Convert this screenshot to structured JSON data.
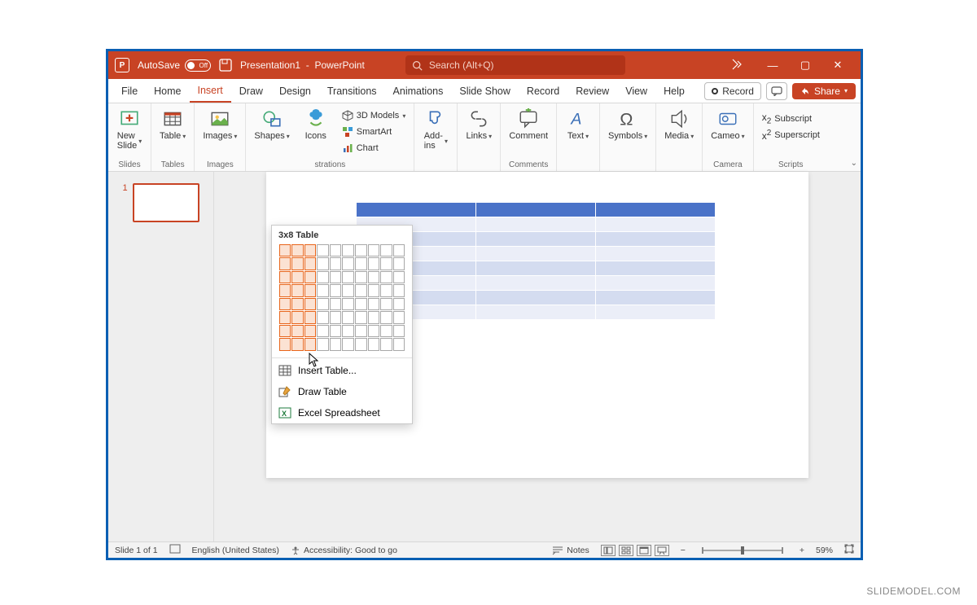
{
  "titlebar": {
    "autosave_label": "AutoSave",
    "autosave_state": "Off",
    "doc_name": "Presentation1",
    "app_name": "PowerPoint",
    "search_placeholder": "Search (Alt+Q)"
  },
  "window": {
    "minimize": "—",
    "maximize": "▢",
    "close": "✕"
  },
  "tabs": {
    "file": "File",
    "home": "Home",
    "insert": "Insert",
    "draw": "Draw",
    "design": "Design",
    "transitions": "Transitions",
    "animations": "Animations",
    "slideshow": "Slide Show",
    "record": "Record",
    "review": "Review",
    "view": "View",
    "help": "Help"
  },
  "tabs_right": {
    "record_btn": "Record",
    "share_btn": "Share"
  },
  "ribbon": {
    "slides": {
      "new_slide": "New\nSlide",
      "group": "Slides"
    },
    "tables": {
      "table": "Table",
      "group": "Tables"
    },
    "images": {
      "images": "Images",
      "group": "Images"
    },
    "illustrations": {
      "shapes": "Shapes",
      "icons": "Icons",
      "models3d": "3D Models",
      "smartart": "SmartArt",
      "chart": "Chart",
      "group": "strations"
    },
    "addins": {
      "addins": "Add-\nins",
      "group": ""
    },
    "links": {
      "links": "Links",
      "group": ""
    },
    "comments": {
      "comment": "Comment",
      "group": "Comments"
    },
    "text": {
      "text": "Text",
      "group": ""
    },
    "symbols": {
      "symbols": "Symbols",
      "group": ""
    },
    "media": {
      "media": "Media",
      "group": ""
    },
    "camera": {
      "cameo": "Cameo",
      "group": "Camera"
    },
    "scripts": {
      "subscript": "Subscript",
      "superscript": "Superscript",
      "group": "Scripts"
    }
  },
  "table_dropdown": {
    "title": "3x8 Table",
    "selected_cols": 3,
    "selected_rows": 8,
    "grid_cols": 10,
    "grid_rows": 8,
    "insert_table": "Insert Table...",
    "draw_table": "Draw Table",
    "excel": "Excel Spreadsheet"
  },
  "preview_table": {
    "cols": 3,
    "rows": 8
  },
  "thumbnail": {
    "number": "1"
  },
  "statusbar": {
    "slide": "Slide 1 of 1",
    "language": "English (United States)",
    "accessibility": "Accessibility: Good to go",
    "notes": "Notes",
    "zoom": "59%"
  },
  "attribution": "SLIDEMODEL.COM"
}
